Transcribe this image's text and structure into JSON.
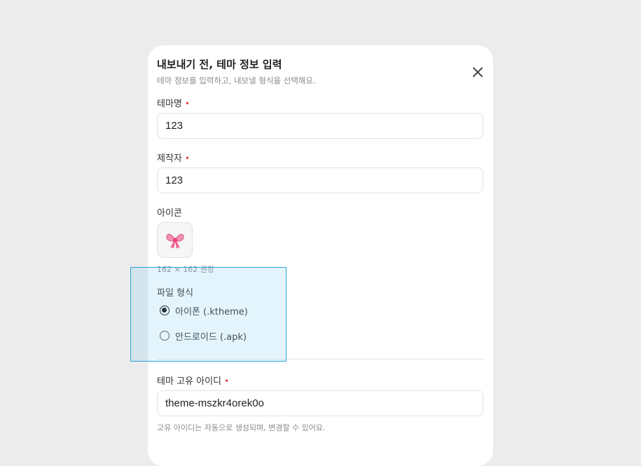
{
  "dialog": {
    "title": "내보내기 전, 테마 정보 입력",
    "subtitle": "테마 정보를 입력하고, 내보낼 형식을 선택해요.",
    "close_icon": "close-icon"
  },
  "fields": {
    "theme_name": {
      "label": "테마명",
      "required_mark": "•",
      "value": "123"
    },
    "author": {
      "label": "제작자",
      "required_mark": "•",
      "value": "123"
    },
    "icon": {
      "label": "아이콘",
      "emoji": "bow-icon",
      "hint": "162 × 162 권장"
    },
    "file_format": {
      "label": "파일 형식",
      "options": [
        {
          "label": "아이폰 (.ktheme)",
          "selected": true
        },
        {
          "label": "안드로이드 (.apk)",
          "selected": false
        }
      ]
    },
    "theme_id": {
      "label": "테마 고유 아이디",
      "required_mark": "•",
      "value": "theme-mszkr4orek0o",
      "hint": "고유 아이디는 자동으로 생성되며, 변경할 수 있어요."
    }
  },
  "colors": {
    "background": "#ececec",
    "required": "#e5484d",
    "selection_overlay": "#2aa3d9"
  }
}
